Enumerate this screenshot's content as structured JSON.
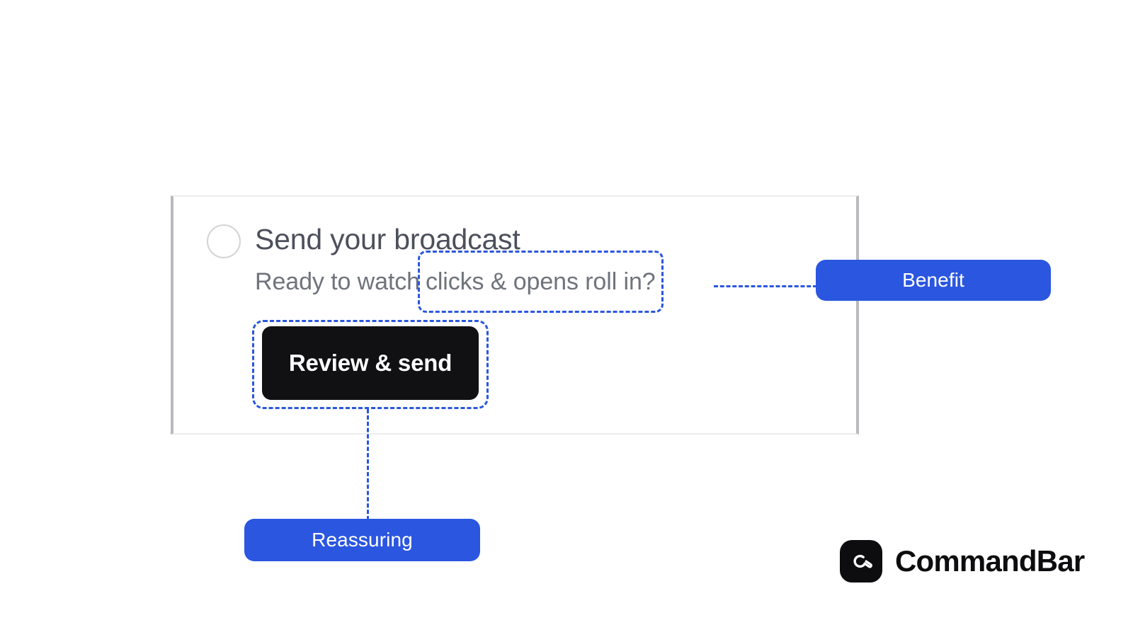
{
  "panel": {
    "step": {
      "radio_state": "unselected",
      "title": "Send your broadcast",
      "subtitle_lead": "Ready to watch",
      "subtitle_highlight": "clicks & opens roll in?",
      "cta_label": "Review & send"
    }
  },
  "annotations": [
    {
      "id": "benefit",
      "label": "Benefit",
      "targets": "subtitle_highlight",
      "color": "#2b56e0"
    },
    {
      "id": "reassuring",
      "label": "Reassuring",
      "targets": "cta_label",
      "color": "#2b56e0"
    }
  ],
  "branding": {
    "logo_icon": "commandbar-logo-icon",
    "wordmark": "CommandBar"
  },
  "colors": {
    "accent": "#2b56e0",
    "cta_background": "#111114",
    "title_text": "#4c505c",
    "subtitle_text": "#6f737c",
    "panel_border_side": "#b9b9bd",
    "panel_border_edge": "#ececec"
  }
}
